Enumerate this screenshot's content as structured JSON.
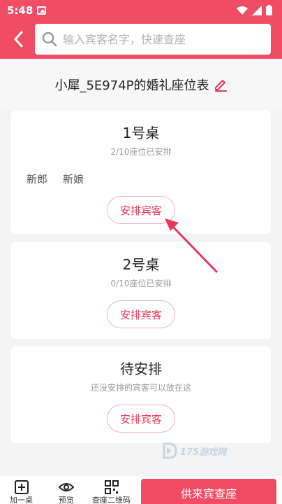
{
  "status_bar": {
    "time": "5:48"
  },
  "header": {
    "search_placeholder": "输入宾客名字，快速查座"
  },
  "page_title": "小犀_5E974P的婚礼座位表",
  "tables": [
    {
      "name": "1号桌",
      "status": "2/10座位已安排",
      "guests": [
        "新郎",
        "新娘"
      ],
      "button": "安排宾客"
    },
    {
      "name": "2号桌",
      "status": "0/10座位已安排",
      "guests": [],
      "button": "安排宾客"
    },
    {
      "name": "待安排",
      "status": "还没安排的宾客可以放在这",
      "guests": [],
      "button": "安排宾客"
    }
  ],
  "bottom_bar": {
    "tabs": [
      {
        "label": "加一桌",
        "icon": "plus-box-icon"
      },
      {
        "label": "预览",
        "icon": "eye-icon"
      },
      {
        "label": "查座二维码",
        "icon": "qr-code-icon"
      }
    ],
    "primary_button": "供来宾查座"
  },
  "watermark": "175游戏网",
  "colors": {
    "accent": "#f04d65",
    "button_text": "#e8385a",
    "background": "#f4f4f4"
  }
}
